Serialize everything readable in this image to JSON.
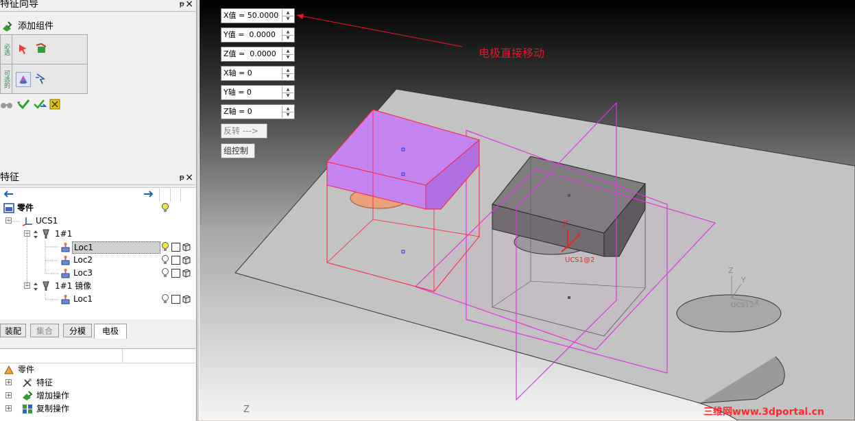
{
  "wizard_panel": {
    "title": "特征向导",
    "pin": "ᵽ",
    "close": "×",
    "add_component": "添加组件",
    "side_required": "必选",
    "side_optional": "可选的"
  },
  "feature_panel": {
    "title": "特征",
    "pin": "ᵽ",
    "close": "×",
    "rows": [
      {
        "label": "零件",
        "bold": true,
        "bulb": true
      },
      {
        "label": "UCS1"
      },
      {
        "label": "1#1"
      },
      {
        "label": "Loc1",
        "bulb": true,
        "selected": true
      },
      {
        "label": "Loc2",
        "bulb": true
      },
      {
        "label": "Loc3",
        "bulb": true
      },
      {
        "label": "1#1 镜像"
      },
      {
        "label": "Loc1",
        "bulb": true
      }
    ]
  },
  "tabs": [
    "装配",
    "集合",
    "分模",
    "电极"
  ],
  "active_tab": "电极",
  "bottom_tree": {
    "rows": [
      {
        "label": "零件"
      },
      {
        "label": "特征"
      },
      {
        "label": "增加操作"
      },
      {
        "label": "复制操作"
      }
    ]
  },
  "viewport": {
    "controls": [
      {
        "label": "X值 = 50.0000"
      },
      {
        "label": "Y值 =  0.0000"
      },
      {
        "label": "Z值 =  0.0000"
      },
      {
        "label": "X轴 = 0"
      },
      {
        "label": "Y轴 = 0"
      },
      {
        "label": "Z轴 = 0"
      }
    ],
    "reverse_button": "反转 --->",
    "group_button": "组控制",
    "annotation": "电极直接移动",
    "axis_label_z": "Z",
    "ucs_labels": [
      "Z",
      "Y",
      "UCS1@2",
      "Z",
      "Y",
      "X",
      "UCS12"
    ],
    "watermark": "三维网www.3dportal.cn"
  },
  "colors": {
    "selected_electrode": "#c584f0",
    "selection_outline": "#ff1f3d",
    "magenta_planes": "#e234e2",
    "annotation_red": "#e8152b"
  }
}
